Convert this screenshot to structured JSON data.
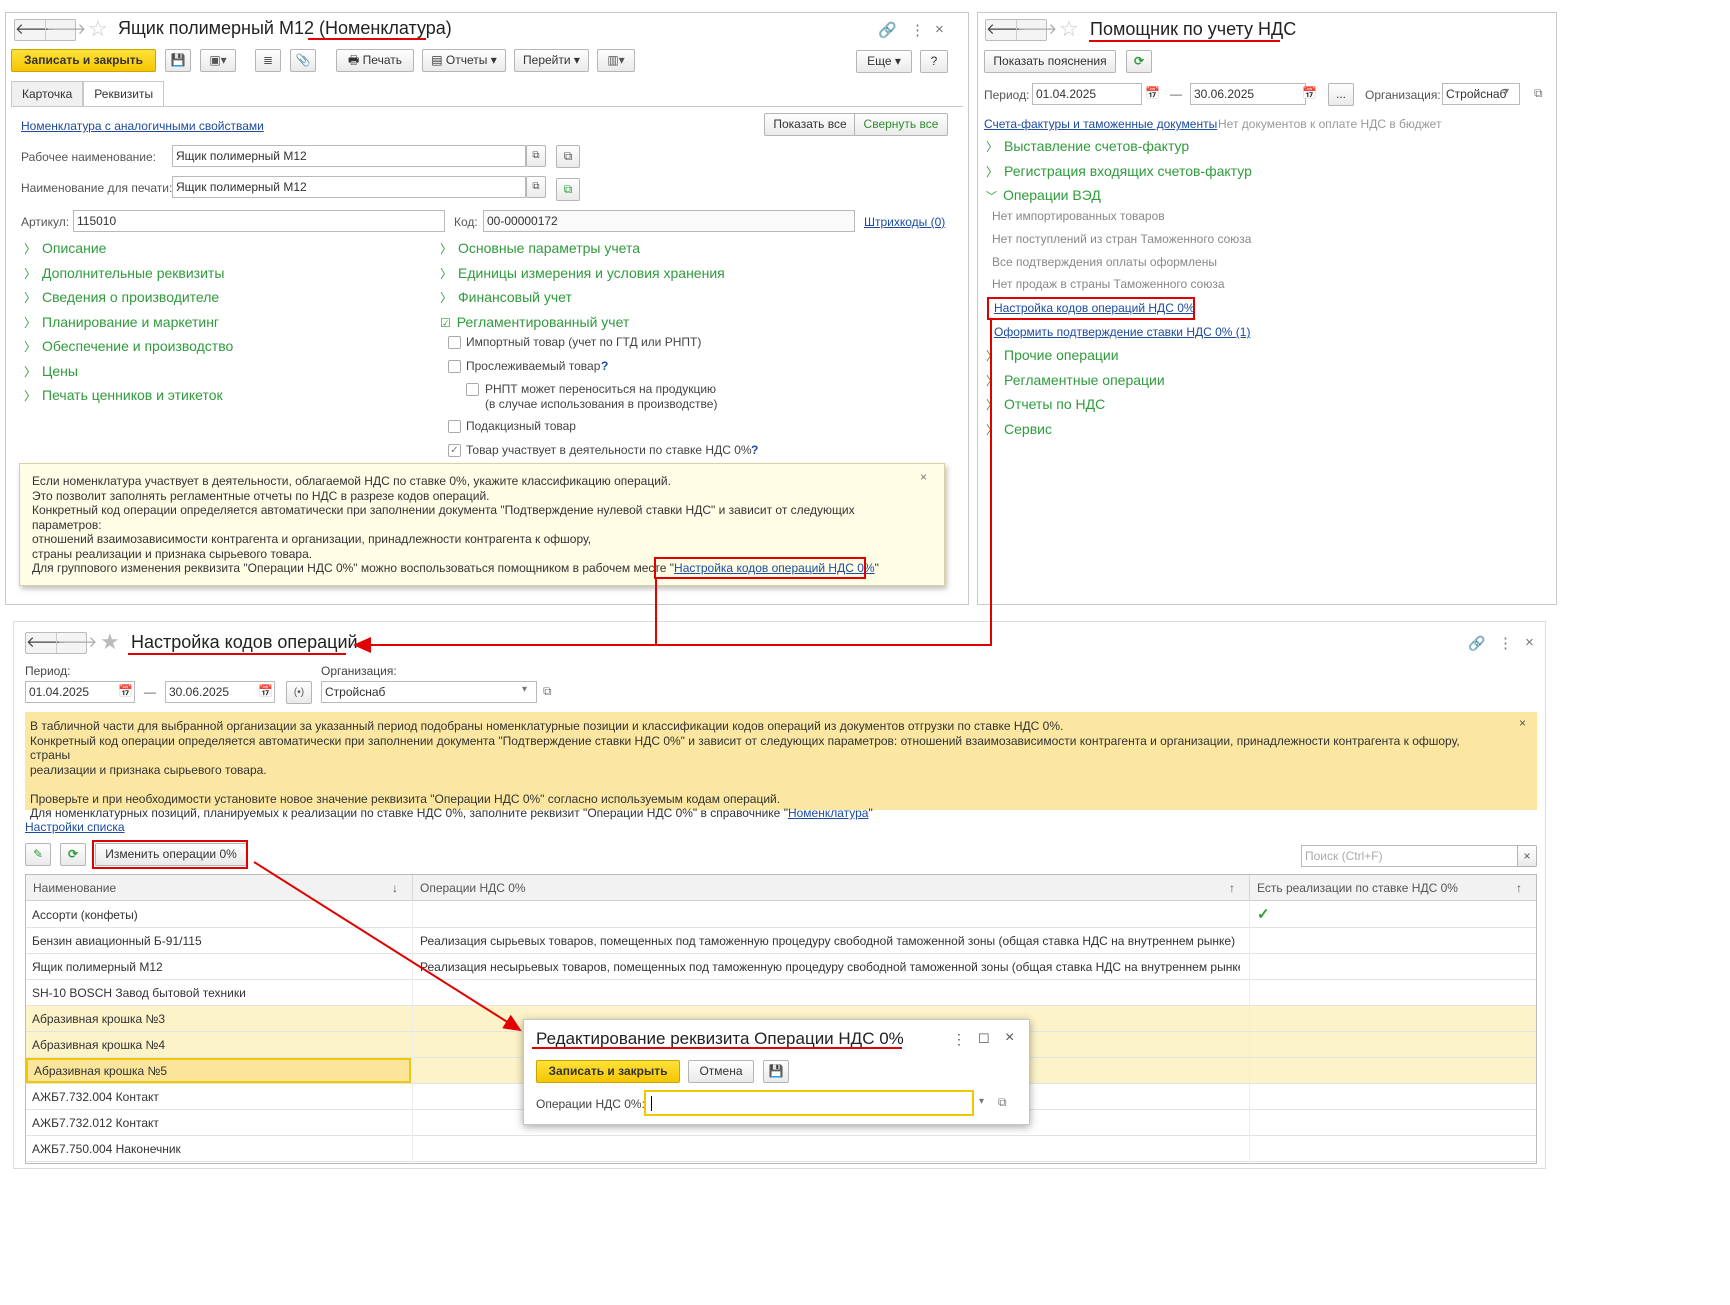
{
  "nomen": {
    "title": "Ящик полимерный М12 (Номенклатура)",
    "save_close": "Записать и закрыть",
    "print": "Печать",
    "reports": "Отчеты",
    "goto": "Перейти",
    "more": "Еще",
    "help": "?",
    "tabs": [
      "Карточка",
      "Реквизиты"
    ],
    "similar_link": "Номенклатура с аналогичными свойствами",
    "show_all": "Показать все",
    "collapse_all": "Свернуть все",
    "work_name_label": "Рабочее наименование:",
    "work_name": "Ящик полимерный М12",
    "print_name_label": "Наименование для печати:",
    "print_name": "Ящик полимерный М12",
    "article_label": "Артикул:",
    "article": "115010",
    "code_label": "Код:",
    "code": "00-00000172",
    "barcodes": "Штрихкоды (0)",
    "left_sections": [
      "Описание",
      "Дополнительные реквизиты",
      "Сведения о производителе",
      "Планирование и маркетинг",
      "Обеспечение и производство",
      "Цены",
      "Печать ценников и этикеток"
    ],
    "right_sections": [
      "Основные параметры учета",
      "Единицы измерения и условия хранения",
      "Финансовый учет",
      "Регламентированный учет"
    ],
    "checkboxes": {
      "import": "Импортный товар (учет по ГТД или РНПТ)",
      "traceable": "Прослеживаемый товар",
      "rnpt1": "РНПТ может переноситься на продукцию",
      "rnpt2": "(в случае использования в производстве)",
      "excise": "Подакцизный товар",
      "vat0": "Товар участвует в деятельности по ставке НДС 0%",
      "q": "?"
    },
    "tooltip_lines": [
      "Если номенклатура участвует в деятельности, облагаемой НДС по ставке 0%, укажите классификацию операций.",
      "Это позволит заполнять регламентные отчеты по НДС в разрезе кодов операций.",
      "Конкретный код операции определяется автоматически при заполнении документа \"Подтверждение нулевой ставки НДС\" и зависит от следующих параметров:",
      "отношений взаимозависимости контрагента и организации, принадлежности контрагента к офшору,",
      "страны реализации и признака сырьевого товара."
    ],
    "tooltip_group": "Для группового изменения реквизита \"Операции НДС 0%\" можно воспользоваться помощником в рабочем месте \"",
    "tooltip_link": "Настройка кодов операций НДС 0%",
    "tooltip_end": "\""
  },
  "helper": {
    "title": "Помощник по учету НДС",
    "show_expl": "Показать пояснения",
    "period_label": "Период:",
    "date_from": "01.04.2025",
    "dash": "—",
    "date_to": "30.06.2025",
    "dots": "...",
    "org_label": "Организация:",
    "org": "Стройснаб",
    "invoices_link": "Счета-фактуры и таможенные документы",
    "no_docs": "Нет документов к оплате НДС в бюджет",
    "sections_top": [
      "Выставление счетов-фактур",
      "Регистрация входящих счетов-фактур",
      "Операции ВЭД"
    ],
    "ved_items": [
      "Нет импортированных товаров",
      "Нет поступлений из стран Таможенного союза",
      "Все подтверждения оплаты оформлены",
      "Нет продаж в страны Таможенного союза"
    ],
    "codes_link": "Настройка кодов операций НДС 0%",
    "confirm_link": "Оформить подтверждение ставки НДС 0% (1)",
    "sections_bottom": [
      "Прочие операции",
      "Регламентные операции",
      "Отчеты по НДС",
      "Сервис"
    ]
  },
  "codes": {
    "title": "Настройка кодов операций",
    "period_label": "Период:",
    "date_from": "01.04.2025",
    "dash": "—",
    "date_to": "30.06.2025",
    "org_label": "Организация:",
    "org": "Стройснаб",
    "info_lines": [
      "В табличной части для выбранной организации за указанный период подобраны номенклатурные позиции и классификации кодов операций из документов отгрузки по ставке НДС 0%.",
      "Конкретный код операции определяется автоматически при заполнении документа \"Подтверждение ставки НДС 0%\" и зависит от следующих параметров: отношений взаимозависимости контрагента и организации, принадлежности контрагента к офшору, страны",
      "реализации и признака сырьевого товара.",
      "",
      "Проверьте и при необходимости установите новое значение реквизита \"Операции НДС 0%\" согласно используемым кодам операций."
    ],
    "info_last": "Для номенклатурных позиций, планируемых к реализации по ставке НДС 0%, заполните реквизит \"Операции НДС 0%\" в справочнике \"",
    "info_link": "Номенклатура",
    "info_end": "\"",
    "list_settings": "Настройки списка",
    "change_ops": "Изменить операции 0%",
    "search_placeholder": "Поиск (Ctrl+F)",
    "columns": [
      "Наименование",
      "Операции НДС 0%",
      "Есть реализации по ставке НДС 0%"
    ],
    "rows": [
      {
        "name": "Ассорти (конфеты)",
        "op": "",
        "check": "✓"
      },
      {
        "name": "Бензин авиационный Б-91/115",
        "op": "Реализация сырьевых товаров, помещенных под таможенную процедуру свободной таможенной зоны (общая ставка НДС на внутреннем рынке)",
        "check": ""
      },
      {
        "name": "Ящик полимерный М12",
        "op": "Реализация несырьевых товаров, помещенных под таможенную процедуру свободной таможенной зоны (общая ставка НДС на внутреннем рынке)",
        "check": ""
      },
      {
        "name": "SH-10 BOSCH Завод бытовой техники",
        "op": "",
        "check": ""
      },
      {
        "name": "Абразивная крошка №3",
        "op": "",
        "check": ""
      },
      {
        "name": "Абразивная крошка №4",
        "op": "",
        "check": ""
      },
      {
        "name": "Абразивная крошка №5",
        "op": "",
        "check": ""
      },
      {
        "name": "АЖБ7.732.004 Контакт",
        "op": "",
        "check": ""
      },
      {
        "name": "АЖБ7.732.012 Контакт",
        "op": "",
        "check": ""
      },
      {
        "name": "АЖБ7.750.004 Наконечник",
        "op": "",
        "check": ""
      }
    ]
  },
  "dialog": {
    "title": "Редактирование реквизита Операции НДС 0%",
    "save_close": "Записать и закрыть",
    "cancel": "Отмена",
    "field_label": "Операции НДС 0%:",
    "field_value": ""
  },
  "colors": {
    "accent_green": "#2f9b3c",
    "link_blue": "#1c4ba1",
    "highlight_red": "#e00000",
    "yellow": "#f5c500"
  }
}
